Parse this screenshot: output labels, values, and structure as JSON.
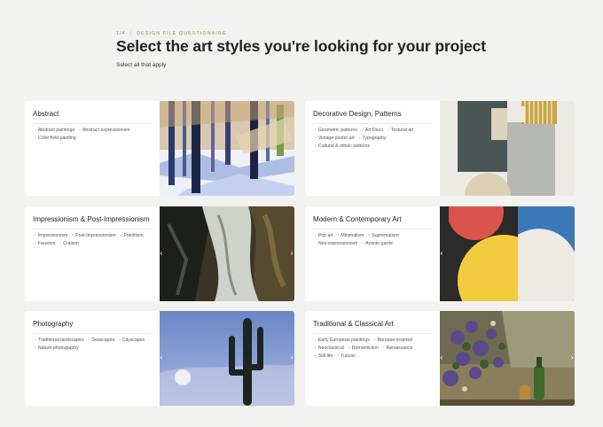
{
  "header": {
    "step": "1/4",
    "section": "DESIGN FILE QUESTIONAIRE",
    "title": "Select the art styles you're looking for your project",
    "subtitle": "Select all that apply"
  },
  "cards": [
    {
      "title": "Abstract",
      "tags": [
        "Abstract paintings",
        "Abstract expressionism",
        "Color field painting"
      ]
    },
    {
      "title": "Decorative Design, Patterns",
      "tags": [
        "Geometric patterns",
        "Art Deco",
        "Textural art",
        "Vintage poster art",
        "Typography",
        "Cultural & ethnic patterns"
      ]
    },
    {
      "title": "Impressionism & Post-Impressionism",
      "tags": [
        "Impressionism",
        "Post-Impressionism",
        "Pointilism",
        "Fauvism",
        "Cubism"
      ]
    },
    {
      "title": "Modern & Contemporary Art",
      "tags": [
        "Pop art",
        "Minimalism",
        "Suprematism",
        "Neo-expressionism",
        "Avante garde"
      ]
    },
    {
      "title": "Photography",
      "tags": [
        "Traditional landscapes",
        "Seascapes",
        "Cityscapes",
        "Nature photography"
      ]
    },
    {
      "title": "Traditional & Classical Art",
      "tags": [
        "Early European paintings",
        "Baroque-inspired",
        "Neoclassical",
        "Romanticism",
        "Renaissance",
        "Still life",
        "Tuscan"
      ]
    }
  ],
  "icons": {
    "prev": "chevron-left-icon",
    "next": "chevron-right-icon"
  },
  "colors": {
    "accent": "#8e9a4a",
    "background": "#f2f2f0",
    "card": "#ffffff"
  }
}
